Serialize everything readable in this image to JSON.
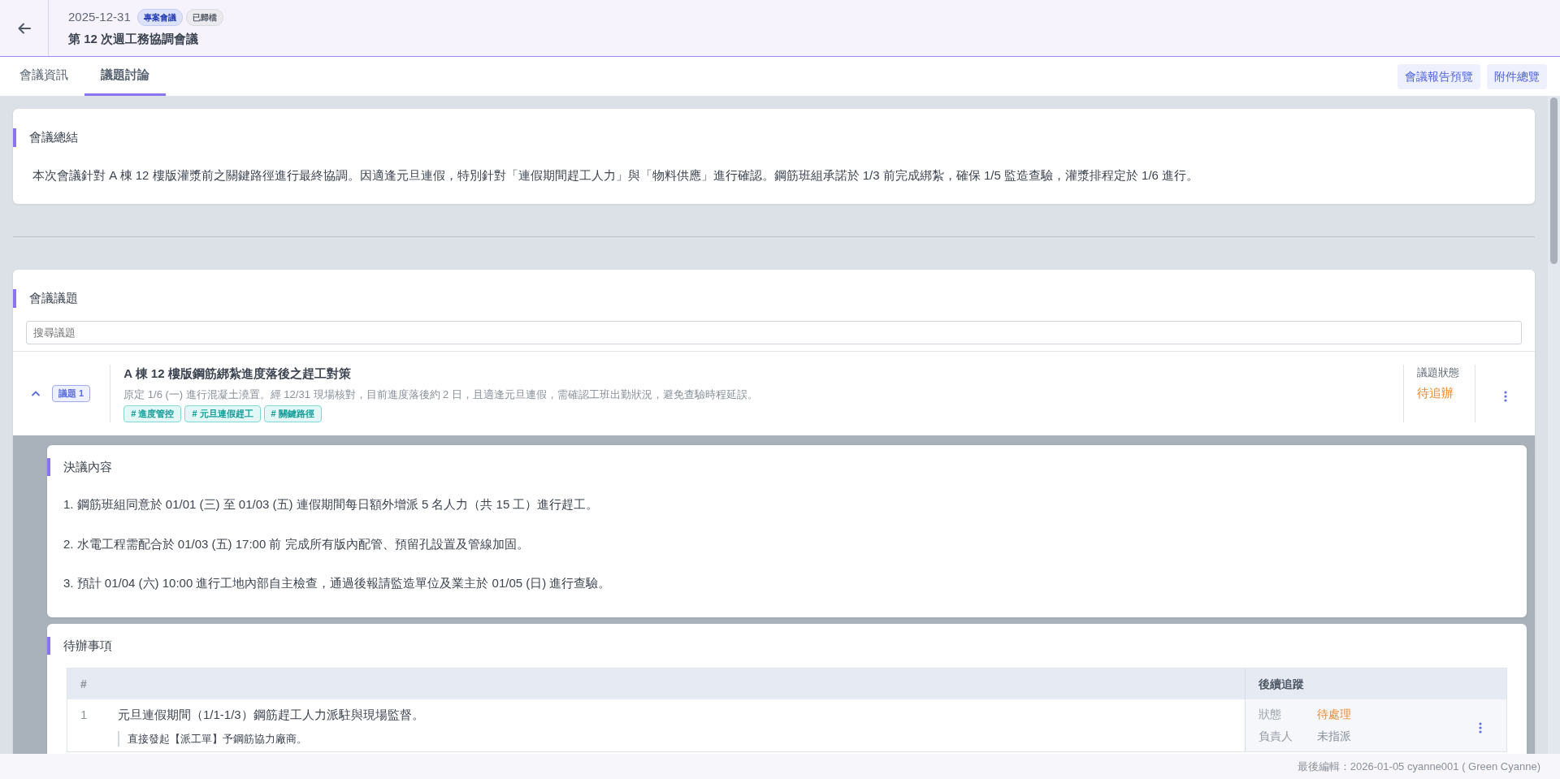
{
  "header": {
    "date": "2025-12-31",
    "tags": [
      {
        "label": "專案會議",
        "kind": "type"
      },
      {
        "label": "已歸檔",
        "kind": "status"
      }
    ],
    "title": "第 12 次週工務協調會議"
  },
  "tabs": [
    {
      "label": "會議資訊",
      "selected": false
    },
    {
      "label": "議題討論",
      "selected": true
    }
  ],
  "actions": [
    "會議報告預覽",
    "附件總覽"
  ],
  "summary": {
    "heading": "會議總結",
    "text": "本次會議針對 A 棟 12 樓版灌漿前之關鍵路徑進行最終協調。因適逢元旦連假，特別針對「連假期間趕工人力」與「物料供應」進行確認。鋼筋班組承諾於 1/3 前完成綁紮，確保 1/5 監造查驗，灌漿排程定於 1/6 進行。"
  },
  "topics_section": {
    "heading": "會議議題",
    "search": {
      "placeholder": "搜尋議題"
    },
    "topics": [
      {
        "expanded": true,
        "badge": "議題 1",
        "title": "A 棟 12 樓版鋼筋綁紮進度落後之趕工對策",
        "description": "原定 1/6 (一) 進行混凝土澆置。經 12/31 現場核對，目前進度落後約 2 日，且適逢元旦連假，需確認工班出勤狀況，避免查驗時程延誤。",
        "tags": [
          "# 進度管控",
          "# 元旦連假趕工",
          "# 關鍵路徑"
        ],
        "status_label": "議題狀態",
        "status": "待追辦",
        "resolution": {
          "heading": "決議內容",
          "items": [
            "1. 鋼筋班組同意於 01/01 (三) 至 01/03 (五) 連假期間每日額外增派 5 名人力（共 15 工）進行趕工。",
            "2. 水電工程需配合於 01/03 (五) 17:00 前 完成所有版內配管、預留孔設置及管線加固。",
            "3. 預計 01/04 (六) 10:00 進行工地內部自主檢查，通過後報請監造單位及業主於 01/05 (日) 進行查驗。"
          ]
        },
        "todos": {
          "heading": "待辦事項",
          "columns": [
            "#",
            "後續追蹤"
          ],
          "rows": [
            {
              "number": "1",
              "title": "元旦連假期間（1/1-1/3）鋼筋趕工人力派駐與現場監督。",
              "note": "直接發起【派工單】予鋼筋協力廠商。",
              "status_label": "狀態",
              "status": "待處理",
              "owner_label": "負責人",
              "owner": "未指派"
            }
          ]
        }
      }
    ]
  },
  "footer": "最後編輯：2026-01-05 cyanne001 ( Green Cyanne)"
}
